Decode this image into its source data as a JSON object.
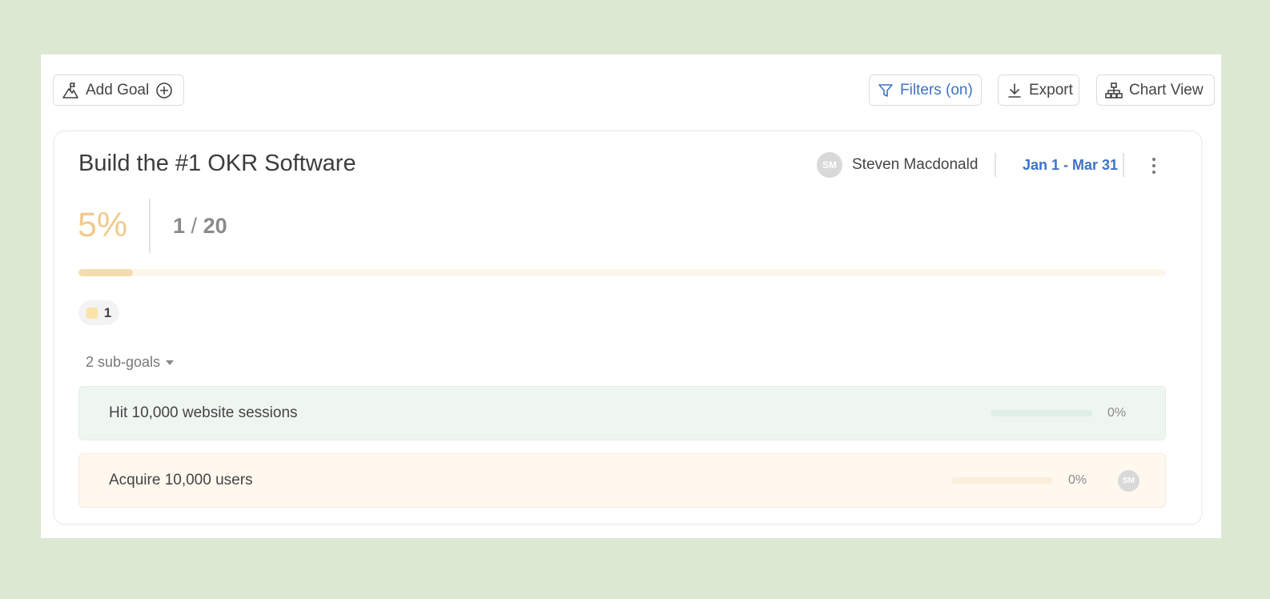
{
  "toolbar": {
    "add_goal_label": "Add Goal",
    "filters_label": "Filters (on)",
    "export_label": "Export",
    "chart_view_label": "Chart View"
  },
  "goal": {
    "title": "Build the #1 OKR Software",
    "owner_initials": "SM",
    "owner_name": "Steven Macdonald",
    "date_range": "Jan 1 - Mar 31",
    "progress_text": "5%",
    "progress_value": 0.05,
    "count_done": "1",
    "count_sep": "/",
    "count_total": "20",
    "badge_count": "1",
    "subgoals_label": "2 sub-goals"
  },
  "subgoals": [
    {
      "title": "Hit 10,000 website sessions",
      "progress_text": "0%",
      "progress_value": 0
    },
    {
      "title": "Acquire 10,000 users",
      "progress_text": "0%",
      "progress_value": 0,
      "owner_initials": "SM"
    }
  ],
  "colors": {
    "background": "#dde8d3",
    "accent_blue": "#3f72c7",
    "progress_orange": "#f2c98d",
    "subgoal_green_bg": "#eff6f1",
    "subgoal_orange_bg": "#fff8ef"
  },
  "icons": {
    "add_goal": "mountain-flag-icon",
    "add": "plus-circle-icon",
    "filters": "funnel-icon",
    "export": "download-icon",
    "chart_view": "org-chart-icon",
    "menu": "kebab-menu-icon"
  }
}
